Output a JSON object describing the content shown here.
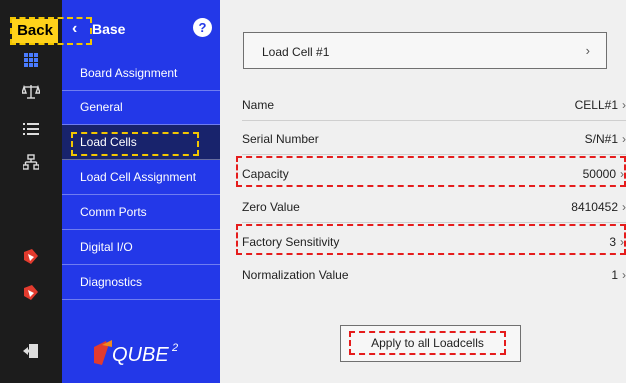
{
  "back": {
    "label": "Back"
  },
  "nav": {
    "title": "Base",
    "help": "?",
    "items": [
      "Board Assignment",
      "General",
      "Load Cells",
      "Load Cell Assignment",
      "Comm Ports",
      "Digital I/O",
      "Diagnostics"
    ],
    "active_item": "Load Cells",
    "logo_text": "QUBE",
    "logo_sup": "2"
  },
  "selector": {
    "label": "Load Cell #1",
    "chevron": "›"
  },
  "fields": [
    {
      "label": "Name",
      "value": "CELL#1"
    },
    {
      "label": "Serial Number",
      "value": "S/N#1"
    },
    {
      "label": "Capacity",
      "value": "50000"
    },
    {
      "label": "Zero Value",
      "value": "8410452"
    },
    {
      "label": "Factory Sensitivity",
      "value": "3"
    },
    {
      "label": "Normalization Value",
      "value": "1"
    }
  ],
  "apply_button": {
    "label": "Apply to all Loadcells"
  },
  "colors": {
    "nav_blue": "#2338e8",
    "nav_active": "#18236c",
    "rail": "#1c1c1c",
    "highlight_yellow": "#f2c600",
    "highlight_red": "#e51c1c"
  },
  "icons": {
    "rail": [
      "grid-icon",
      "scale-icon",
      "list-icon",
      "network-icon",
      "tag-icon",
      "tag-icon",
      "logout-icon"
    ]
  }
}
